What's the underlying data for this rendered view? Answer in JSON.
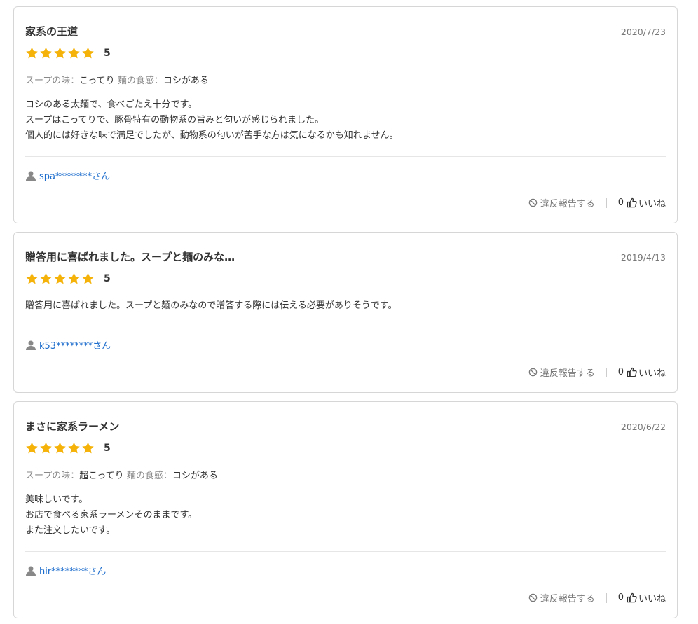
{
  "colors": {
    "star": "#f5b30a",
    "link": "#1a6bcc",
    "border": "#d6d6d6"
  },
  "reviews": [
    {
      "title": "家系の王道",
      "date": "2020/7/23",
      "stars": 5,
      "score": "5",
      "attrs": [
        {
          "label": "スープの味：",
          "value": "こってり"
        },
        {
          "label": "麺の食感：",
          "value": "コシがある"
        }
      ],
      "body": [
        "コシのある太麺で、食べごたえ十分です。",
        "スープはこってりで、豚骨特有の動物系の旨みと匂いが感じられました。",
        "個人的には好きな味で満足でしたが、動物系の匂いが苦手な方は気になるかも知れません。"
      ],
      "user": "spa********さん",
      "report_label": "違反報告する",
      "like_count": "0",
      "like_label": "いいね"
    },
    {
      "title": "贈答用に喜ばれました。スープと麺のみな…",
      "date": "2019/4/13",
      "stars": 5,
      "score": "5",
      "attrs": [],
      "body": [
        "贈答用に喜ばれました。スープと麺のみなので贈答する際には伝える必要がありそうです。"
      ],
      "user": "k53********さん",
      "report_label": "違反報告する",
      "like_count": "0",
      "like_label": "いいね"
    },
    {
      "title": "まさに家系ラーメン",
      "date": "2020/6/22",
      "stars": 5,
      "score": "5",
      "attrs": [
        {
          "label": "スープの味：",
          "value": "超こってり"
        },
        {
          "label": "麺の食感：",
          "value": "コシがある"
        }
      ],
      "body": [
        "美味しいです。",
        "お店で食べる家系ラーメンそのままです。",
        "また注文したいです。"
      ],
      "user": "hir********さん",
      "report_label": "違反報告する",
      "like_count": "0",
      "like_label": "いいね"
    }
  ]
}
